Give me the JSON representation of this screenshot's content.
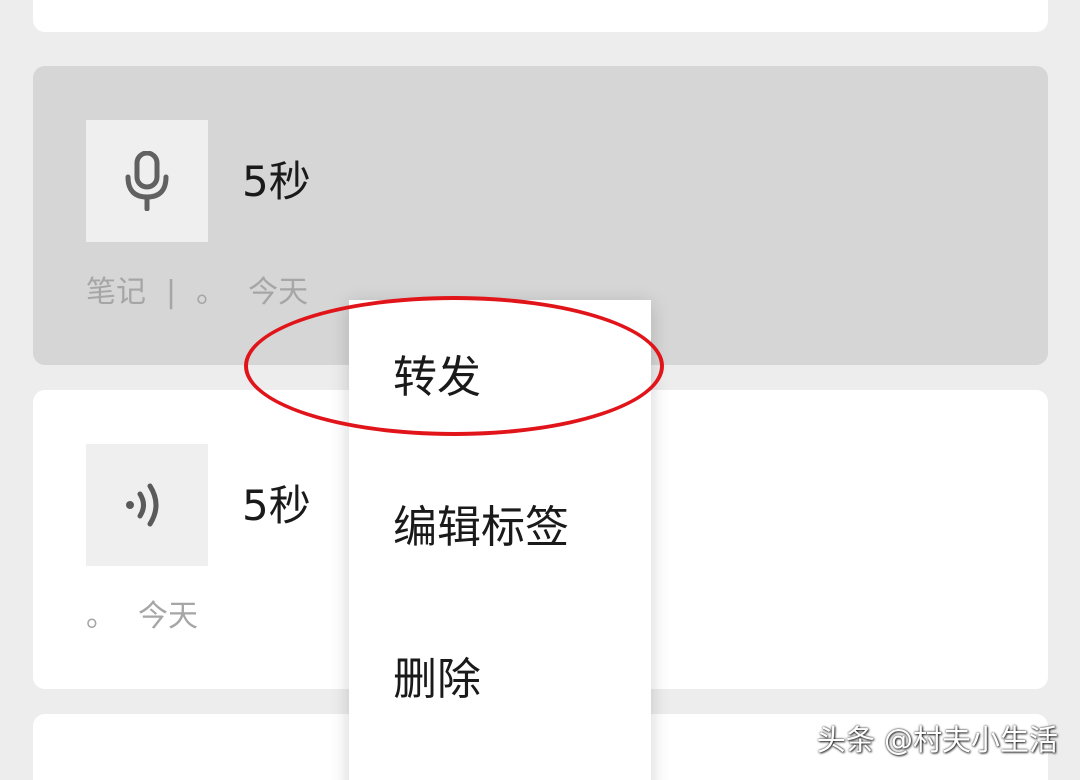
{
  "cards": [
    {
      "duration": "5秒",
      "category": "笔记",
      "separator": "|",
      "punct": "。",
      "date": "今天",
      "icon": "microphone-icon",
      "state": "pressed"
    },
    {
      "duration": "5秒",
      "punct": "。",
      "date": "今天",
      "icon": "voice-playback-icon",
      "state": "normal"
    }
  ],
  "context_menu": {
    "items": [
      "转发",
      "编辑标签",
      "删除"
    ],
    "highlighted": "转发"
  },
  "annotation": {
    "color": "#e1141a",
    "shape": "ellipse"
  },
  "watermark": "头条 @村夫小生活",
  "colors": {
    "background": "#ededed",
    "card": "#ffffff",
    "card_pressed": "#d6d6d6",
    "meta_text": "#a6a6a6"
  }
}
